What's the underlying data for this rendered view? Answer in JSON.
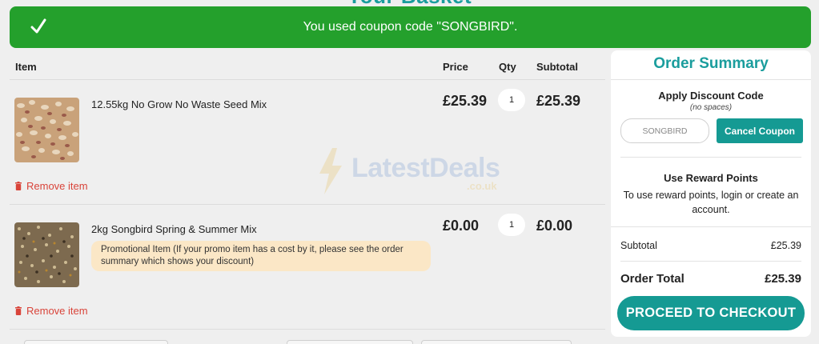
{
  "page": {
    "heading": "Your Basket"
  },
  "alert": {
    "message": "You used coupon code \"SONGBIRD\"."
  },
  "cart": {
    "headers": {
      "item": "Item",
      "price": "Price",
      "qty": "Qty",
      "subtotal": "Subtotal"
    },
    "items": [
      {
        "name": "12.55kg No Grow No Waste Seed Mix",
        "price": "£25.39",
        "qty": "1",
        "subtotal": "£25.39",
        "remove_label": "Remove item"
      },
      {
        "name": "2kg Songbird Spring & Summer Mix",
        "price": "£0.00",
        "qty": "1",
        "subtotal": "£0.00",
        "remove_label": "Remove item",
        "promo_note": "Promotional Item (If your promo item has a cost by it, please see the order summary which shows your discount)"
      }
    ]
  },
  "watermark": {
    "text": "LatestDeals",
    "sub": ".co.uk"
  },
  "summary": {
    "title": "Order Summary",
    "discount_title": "Apply Discount Code",
    "discount_note": "(no spaces)",
    "code_value": "SONGBIRD",
    "cancel_label": "Cancel Coupon",
    "reward_title": "Use Reward Points",
    "reward_text": "To use reward points, login or create an account.",
    "subtotal_label": "Subtotal",
    "subtotal_value": "£25.39",
    "total_label": "Order Total",
    "total_value": "£25.39",
    "checkout_label": "PROCEED TO CHECKOUT"
  },
  "colors": {
    "success": "#24a02c",
    "accent": "#159a93",
    "heading": "#1a9d9d",
    "remove": "#d9443a",
    "promo_bg": "#fbe7c6"
  }
}
